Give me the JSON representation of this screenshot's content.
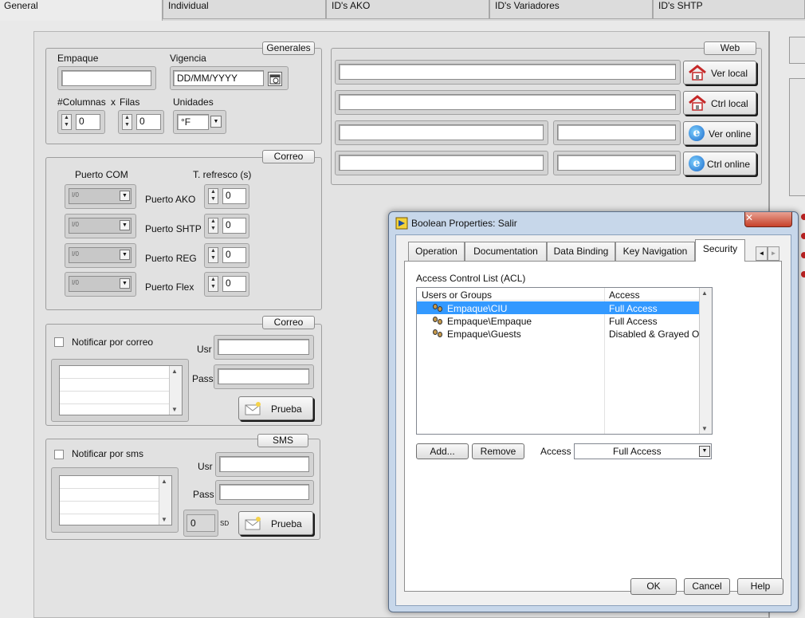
{
  "tabs": [
    {
      "label": "General",
      "active": true
    },
    {
      "label": "Individual"
    },
    {
      "label": "ID's AKO"
    },
    {
      "label": "ID's Variadores"
    },
    {
      "label": "ID's SHTP"
    }
  ],
  "generales": {
    "title": "Generales",
    "empaque_label": "Empaque",
    "empaque_value": "",
    "vigencia_label": "Vigencia",
    "vigencia_value": "DD/MM/YYYY",
    "columnas_label": "#Columnas",
    "x_label": "x",
    "filas_label": "Filas",
    "columnas_value": "0",
    "filas_value": "0",
    "unidades_label": "Unidades",
    "unidades_value": "°F"
  },
  "correo_ports": {
    "title": "Correo",
    "puerto_com_label": "Puerto COM",
    "refresco_label": "T. refresco (s)",
    "io_glyph": "I/0",
    "rows": [
      {
        "label": "Puerto AKO",
        "value": "0"
      },
      {
        "label": "Puerto SHTP",
        "value": "0"
      },
      {
        "label": "Puerto REG",
        "value": "0"
      },
      {
        "label": "Puerto Flex",
        "value": "0"
      }
    ]
  },
  "correo_notify": {
    "title": "Correo",
    "checkbox_label": "Notificar por correo",
    "usr_label": "Usr",
    "pass_label": "Pass",
    "prueba_label": "Prueba"
  },
  "sms": {
    "title": "SMS",
    "checkbox_label": "Notificar por sms",
    "usr_label": "Usr",
    "pass_label": "Pass",
    "count_value": "0",
    "suffix": "SD",
    "prueba_label": "Prueba"
  },
  "web": {
    "title": "Web",
    "ver_local": "Ver local",
    "ctrl_local": "Ctrl  local",
    "ver_online": "Ver online",
    "ctrl_online": "Ctrl  online"
  },
  "dialog": {
    "title": "Boolean Properties: Salir",
    "tabs": [
      "Operation",
      "Documentation",
      "Data Binding",
      "Key Navigation",
      "Security"
    ],
    "selected_tab": "Security",
    "acl_label": "Access Control List (ACL)",
    "col_users": "Users or Groups",
    "col_access": "Access",
    "rows": [
      {
        "user": "Empaque\\CIU",
        "access": "Full Access",
        "selected": true
      },
      {
        "user": "Empaque\\Empaque",
        "access": "Full Access"
      },
      {
        "user": "Empaque\\Guests",
        "access": "Disabled & Grayed O"
      }
    ],
    "add_label": "Add...",
    "remove_label": "Remove",
    "access_label": "Access",
    "access_value": "Full Access",
    "ok_label": "OK",
    "cancel_label": "Cancel",
    "help_label": "Help"
  }
}
